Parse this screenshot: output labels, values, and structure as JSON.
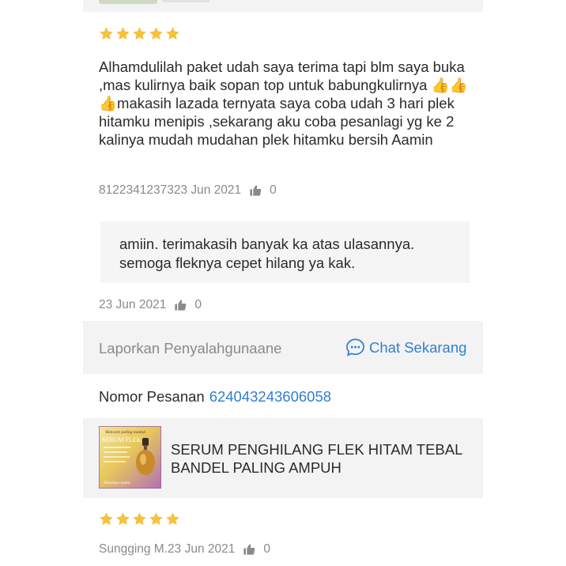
{
  "review": {
    "rating": 5,
    "text": "Alhamdulilah paket udah saya terima tapi blm saya buka ,mas kulirnya baik sopan top untuk babungkulirnya 👍👍👍makasih lazada ternyata saya coba udah 3 hari plek hitamku menipis ,sekarang aku coba pesanlagi  yg ke 2 kalinya mudah mudahan plek hitamku bersih Aamin",
    "author_date": "8122341237323 Jun 2021",
    "likes": "0"
  },
  "reply": {
    "text": "amiin. terimakasih banyak ka atas ulasannya. semoga fleknya cepet hilang ya kak.",
    "date": "23 Jun 2021",
    "likes": "0"
  },
  "actions": {
    "report_label": "Laporkan Penyalahgunaane",
    "chat_label": "Chat Sekarang"
  },
  "order": {
    "label": "Nomor Pesanan",
    "number": "624043243606058"
  },
  "product": {
    "name": "SERUM PENGHILANG FLEK HITAM TEBAL BANDEL PALING AMPUH",
    "image_text_top": "Skincare paling mantul",
    "image_text_title": "SERUM FLEK",
    "image_text_bottom": "Hasilnya nyata"
  },
  "review2": {
    "rating": 5,
    "author_date": "Sungging M.23 Jun 2021",
    "likes": "0"
  },
  "colors": {
    "star": "#f6c13b",
    "link": "#2f7fd1",
    "muted": "#8a8a8a",
    "panel": "#f3f3f3"
  }
}
